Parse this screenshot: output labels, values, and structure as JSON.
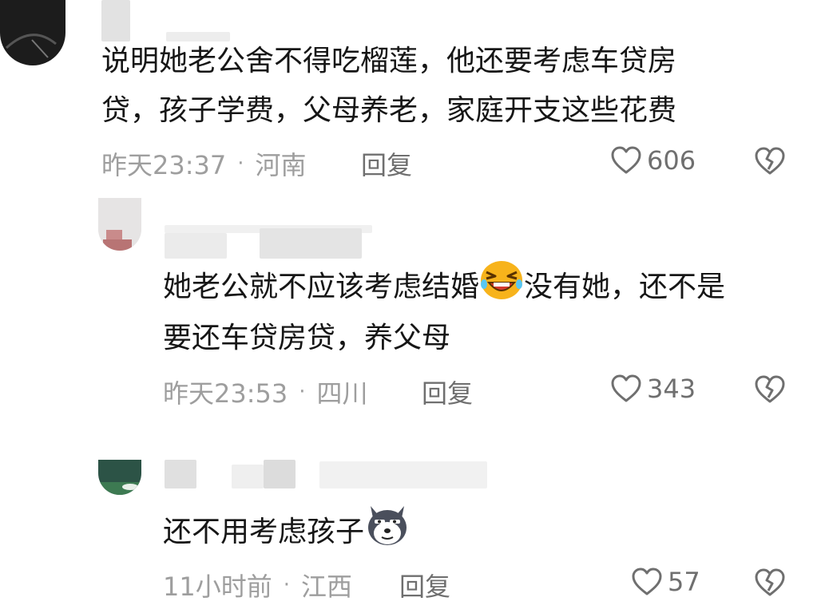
{
  "comments": [
    {
      "text_line1": "说明她老公舍不得吃榴莲，他还要考虑车贷房",
      "text_line2": "贷，孩子学费，父母养老，家庭开支这些花费",
      "time": "昨天23:37",
      "location": "河南",
      "reply": "回复",
      "likes": "606"
    },
    {
      "text_line1_a": "她老公就不应该考虑结婚",
      "emoji1": "laughing-emoji",
      "text_line1_b": "没有她，还不是",
      "text_line2": "要还车贷房贷，养父母",
      "time": "昨天23:53",
      "location": "四川",
      "reply": "回复",
      "likes": "343"
    },
    {
      "text": "还不用考虑孩子",
      "emoji": "husky-dog-emoji",
      "time": "11小时前",
      "location": "江西",
      "reply": "回复",
      "likes": "57"
    }
  ],
  "separator": "·",
  "icons": {
    "like": "heart-outline-icon",
    "dislike": "broken-heart-icon"
  },
  "colors": {
    "text": "#161616",
    "meta": "#9e9e9e",
    "action": "#6f6f6f"
  }
}
